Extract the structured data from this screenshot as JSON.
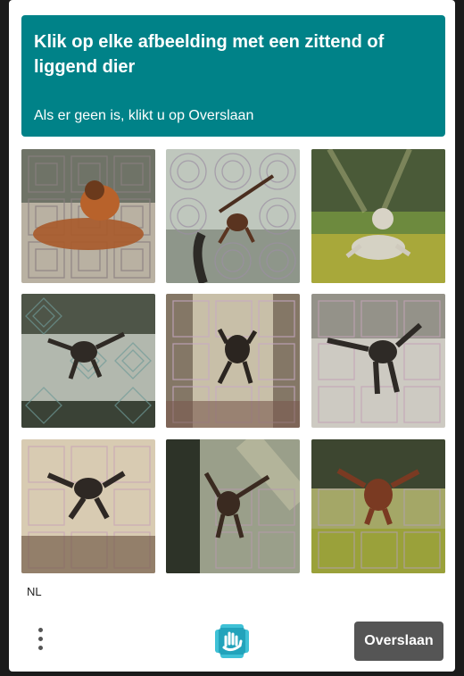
{
  "challenge": {
    "title": "Klik op elke afbeelding met een zittend of liggend dier",
    "subtitle": "Als er geen is, klikt u op Overslaan"
  },
  "images": [
    {
      "name": "image-1"
    },
    {
      "name": "image-2"
    },
    {
      "name": "image-3"
    },
    {
      "name": "image-4"
    },
    {
      "name": "image-5"
    },
    {
      "name": "image-6"
    },
    {
      "name": "image-7"
    },
    {
      "name": "image-8"
    },
    {
      "name": "image-9"
    }
  ],
  "footer": {
    "language": "NL",
    "skip_label": "Overslaan",
    "menu_icon": "more-vertical-icon",
    "logo_icon": "hcaptcha-logo-icon"
  },
  "colors": {
    "banner": "#008288",
    "skip_button": "#555555"
  }
}
